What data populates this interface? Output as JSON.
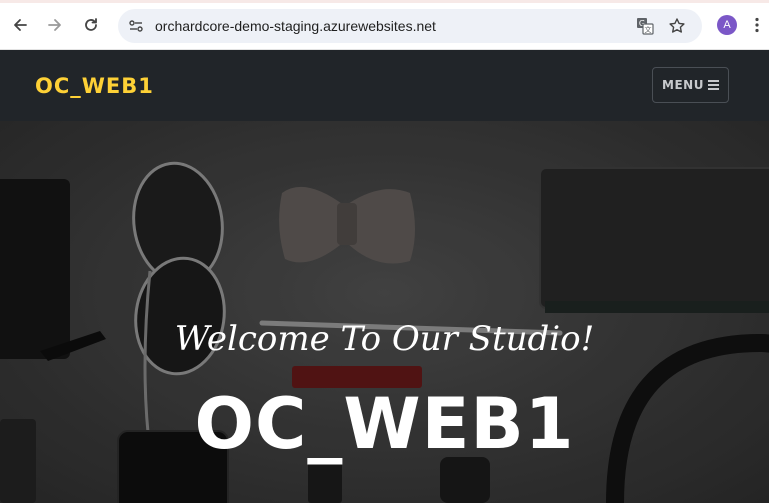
{
  "browser": {
    "url": "orchardcore-demo-staging.azurewebsites.net",
    "avatar_letter": "A",
    "icons": [
      "back-arrow-icon",
      "forward-arrow-icon",
      "reload-icon",
      "site-info-icon",
      "translate-icon",
      "bookmark-star-icon",
      "more-vert-icon"
    ]
  },
  "header": {
    "brand": "OC_WEB1",
    "menu_label": "MENU",
    "brand_color": "#fed136",
    "background": "#212529"
  },
  "hero": {
    "lead": "Welcome To Our Studio!",
    "heading": "OC_WEB1"
  }
}
